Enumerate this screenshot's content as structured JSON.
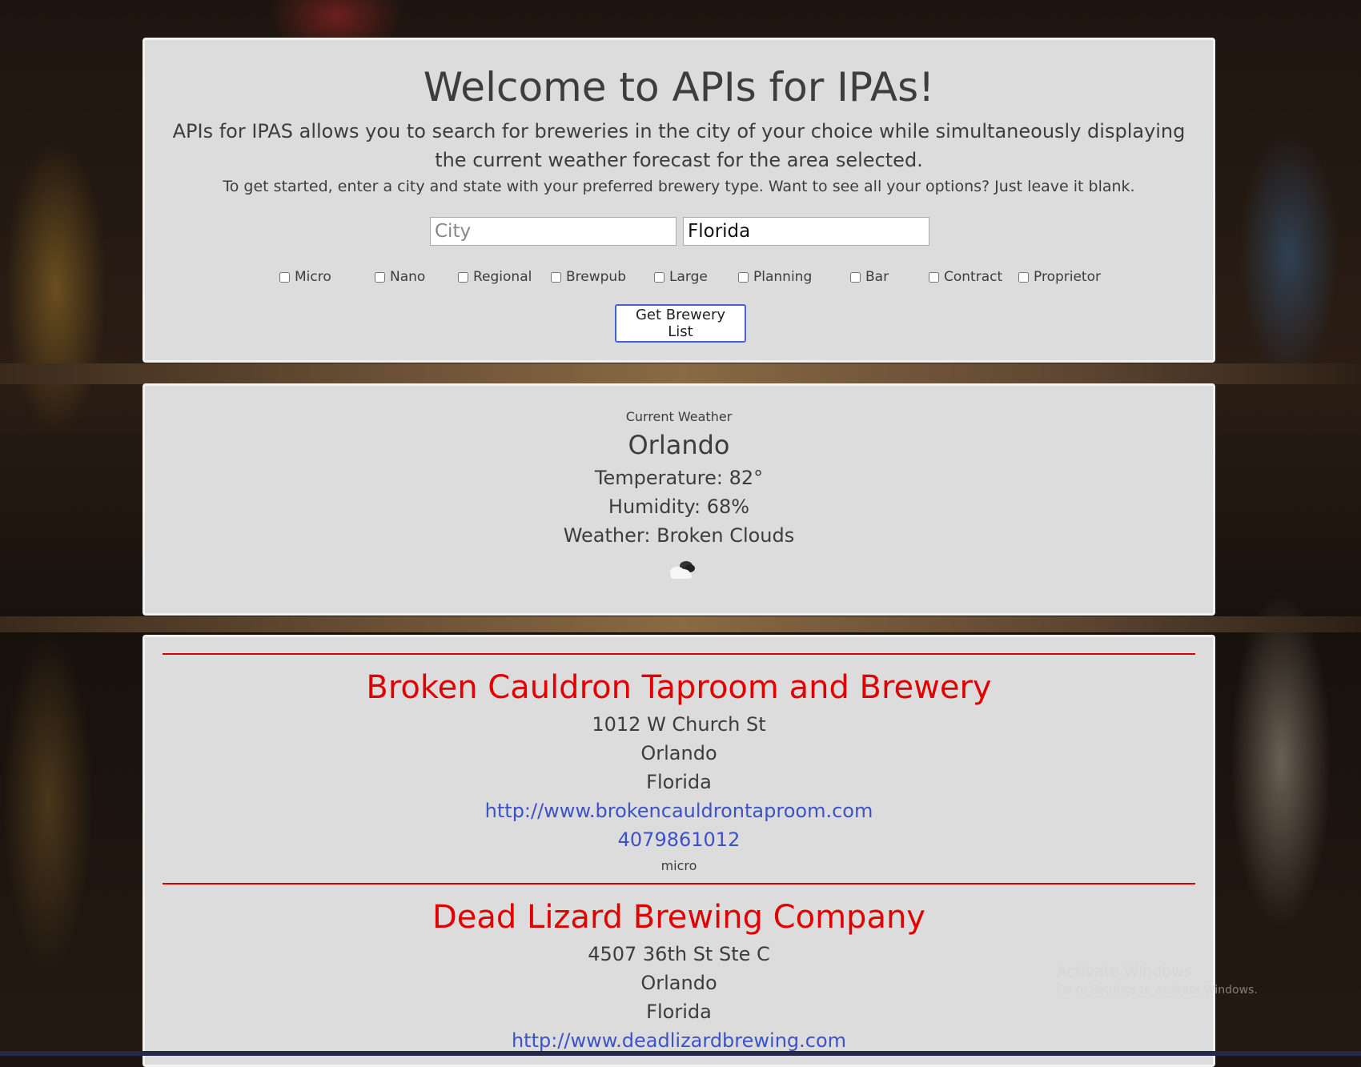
{
  "header": {
    "title": "Welcome to APIs for IPAs!",
    "lead": "APIs for IPAS allows you to search for breweries in the city of your choice while simultaneously displaying the current weather forecast for the area selected.",
    "instructions": "To get started, enter a city and state with your preferred brewery type. Want to see all your options? Just leave it blank."
  },
  "search": {
    "city_placeholder": "City",
    "city_value": "",
    "state_value": "Florida",
    "types": [
      {
        "label": "Micro",
        "checked": false
      },
      {
        "label": "Nano",
        "checked": false
      },
      {
        "label": "Regional",
        "checked": false
      },
      {
        "label": "Brewpub",
        "checked": false
      },
      {
        "label": "Large",
        "checked": false
      },
      {
        "label": "Planning",
        "checked": false
      },
      {
        "label": "Bar",
        "checked": false
      },
      {
        "label": "Contract",
        "checked": false
      },
      {
        "label": "Proprietor",
        "checked": false
      }
    ],
    "button_label": "Get Brewery List"
  },
  "weather": {
    "label": "Current Weather",
    "city": "Orlando",
    "temperature": "Temperature: 82°",
    "humidity": "Humidity: 68%",
    "description": "Weather: Broken Clouds",
    "icon": "broken-clouds-icon"
  },
  "breweries": [
    {
      "name": "Broken Cauldron Taproom and Brewery",
      "street": "1012 W Church St",
      "city": "Orlando",
      "state": "Florida",
      "url": "http://www.brokencauldrontaproom.com",
      "phone": "4079861012",
      "type": "micro"
    },
    {
      "name": "Dead Lizard Brewing Company",
      "street": "4507 36th St Ste C",
      "city": "Orlando",
      "state": "Florida",
      "url": "http://www.deadlizardbrewing.com"
    }
  ],
  "watermark": {
    "line1": "Activate Windows",
    "line2": "Go to Settings to activate Windows."
  },
  "colors": {
    "panel": "#dcdcdc",
    "brewery_name": "#e00000",
    "link": "#3c52c6",
    "divider": "#d40000"
  }
}
